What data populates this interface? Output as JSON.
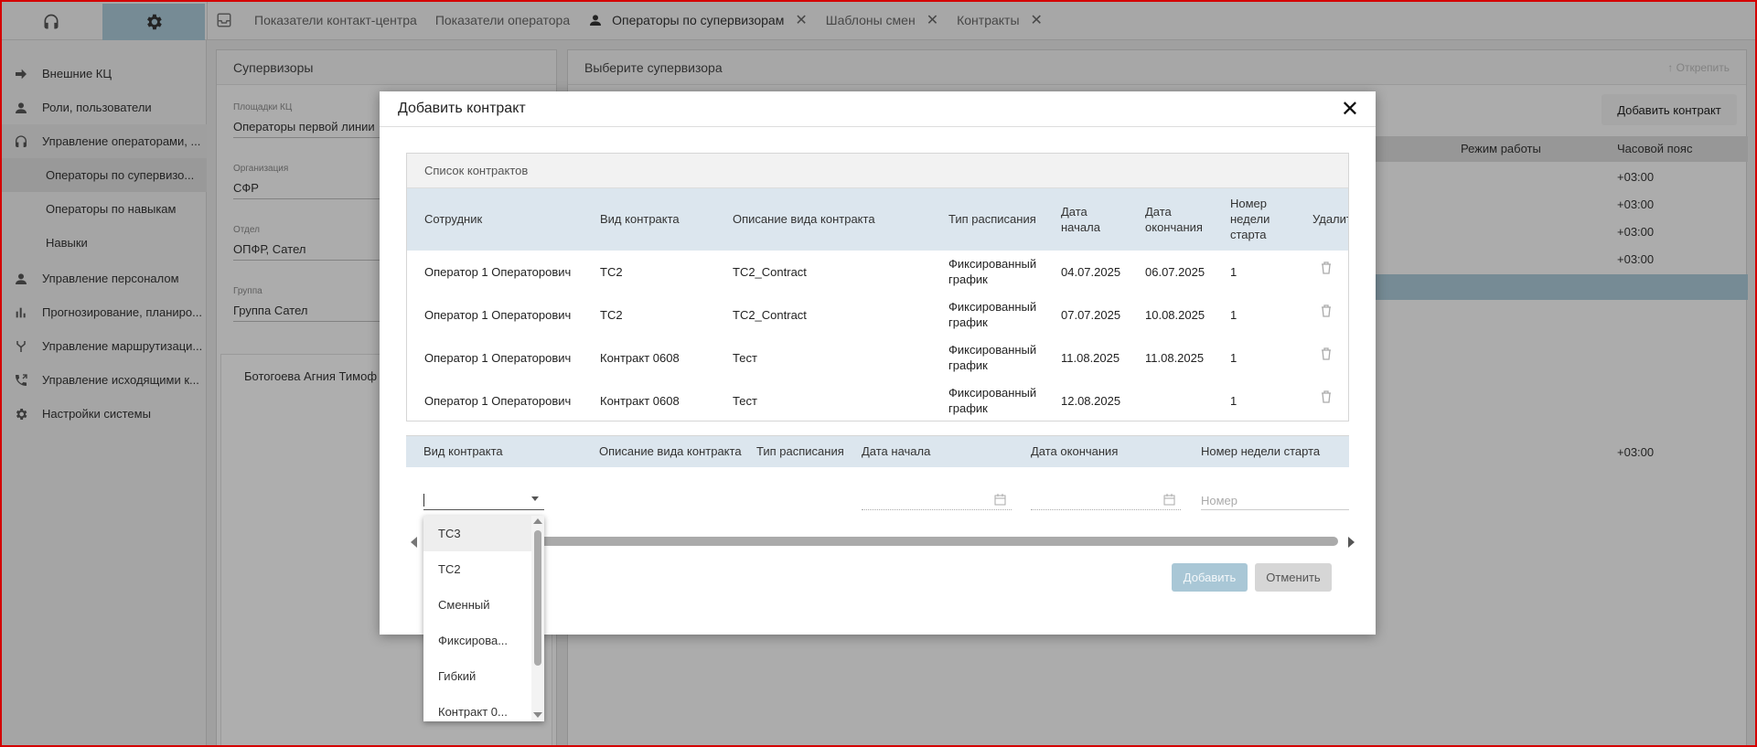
{
  "tabs": [
    {
      "label": "Показатели контакт-центра",
      "closable": false,
      "active": false
    },
    {
      "label": "Показатели оператора",
      "closable": false,
      "active": false
    },
    {
      "label": "Операторы по супервизорам",
      "closable": true,
      "active": true
    },
    {
      "label": "Шаблоны смен",
      "closable": true,
      "active": false
    },
    {
      "label": "Контракты",
      "closable": true,
      "active": false
    }
  ],
  "sidebar": {
    "items": [
      {
        "label": "Внешние КЦ",
        "icon": "arrow-right-icon"
      },
      {
        "label": "Роли, пользователи",
        "icon": "person-icon"
      },
      {
        "label": "Управление операторами, ...",
        "icon": "headset-icon"
      },
      {
        "label": "Операторы по супервизо...",
        "sub": true
      },
      {
        "label": "Операторы по навыкам",
        "sub": true
      },
      {
        "label": "Навыки",
        "sub": true
      },
      {
        "label": "Управление персоналом",
        "icon": "person-icon"
      },
      {
        "label": "Прогнозирование, планиро...",
        "icon": "bar-chart-icon"
      },
      {
        "label": "Управление маршрутизаци...",
        "icon": "fork-icon"
      },
      {
        "label": "Управление исходящими к...",
        "icon": "phone-out-icon"
      },
      {
        "label": "Настройки системы",
        "icon": "gear-icon"
      }
    ]
  },
  "supervisors": {
    "title": "Супервизоры",
    "fields": [
      {
        "label": "Площадки КЦ",
        "value": "Операторы первой линии"
      },
      {
        "label": "Организация",
        "value": "СФР"
      },
      {
        "label": "Отдел",
        "value": "ОПФР, Сател"
      },
      {
        "label": "Группа",
        "value": "Группа Сател"
      }
    ],
    "person": "Ботогоева Агния Тимоф"
  },
  "right_panel": {
    "title": "Выберите супервизора",
    "detach_label": "Открепить",
    "add_contract_label": "Добавить контракт",
    "col_mode": "Режим работы",
    "col_tz": "Часовой пояс",
    "tz_values": [
      "+03:00",
      "+03:00",
      "+03:00",
      "+03:00",
      "+03:00"
    ]
  },
  "modal": {
    "title": "Добавить контракт",
    "list_caption": "Список контрактов",
    "headers": {
      "employee": "Сотрудник",
      "type": "Вид контракта",
      "desc": "Описание вида контракта",
      "schedule": "Тип расписания",
      "start": "Дата начала",
      "end": "Дата окончания",
      "week": "Номер недели старта",
      "delete": "Удалить"
    },
    "rows": [
      {
        "employee": "Оператор 1 Операторович",
        "type": "ТС2",
        "desc": "ТС2_Contract",
        "schedule": "Фиксированный график",
        "start": "04.07.2025",
        "end": "06.07.2025",
        "week": "1"
      },
      {
        "employee": "Оператор 1 Операторович",
        "type": "ТС2",
        "desc": "ТС2_Contract",
        "schedule": "Фиксированный график",
        "start": "07.07.2025",
        "end": "10.08.2025",
        "week": "1"
      },
      {
        "employee": "Оператор 1 Операторович",
        "type": "Контракт 0608",
        "desc": "Тест",
        "schedule": "Фиксированный график",
        "start": "11.08.2025",
        "end": "11.08.2025",
        "week": "1"
      },
      {
        "employee": "Оператор 1 Операторович",
        "type": "Контракт 0608",
        "desc": "Тест",
        "schedule": "Фиксированный график",
        "start": "12.08.2025",
        "end": "",
        "week": "1"
      }
    ],
    "new_headers": {
      "type": "Вид контракта",
      "desc": "Описание вида контракта",
      "schedule": "Тип расписания",
      "start": "Дата начала",
      "end": "Дата окончания",
      "week": "Номер недели старта"
    },
    "week_placeholder": "Номер",
    "add_button": "Добавить",
    "cancel_button": "Отменить"
  },
  "dropdown": {
    "options": [
      "ТС3",
      "ТС2",
      "Сменный",
      "Фиксирова...",
      "Гибкий",
      "Контракт 0..."
    ],
    "highlighted_index": 0
  },
  "colors": {
    "accent": "#a9c7d6",
    "table_header": "#dce6ee",
    "frame": "#d40000"
  }
}
